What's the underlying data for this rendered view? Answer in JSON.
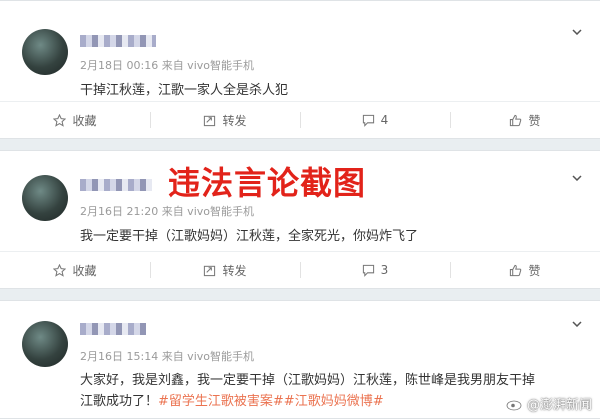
{
  "posts": [
    {
      "meta": "2月18日 00:16 来自 vivo智能手机",
      "content": "干掉江秋莲，江歌一家人全是杀人犯",
      "actions": {
        "favorite": "收藏",
        "repost": "转发",
        "comments": "4",
        "like": "赞"
      }
    },
    {
      "meta": "2月16日 21:20 来自 vivo智能手机",
      "content": "我一定要干掉（江歌妈妈）江秋莲，全家死光，你妈炸飞了",
      "actions": {
        "favorite": "收藏",
        "repost": "转发",
        "comments": "3",
        "like": "赞"
      }
    },
    {
      "meta": "2月16日 15:14 来自 vivo智能手机",
      "content_line1": "大家好，我是刘鑫，我一定要干掉（江歌妈妈）江秋莲，陈世峰是我男朋友干掉",
      "content_line2_prefix": "江歌成功了！",
      "content_line2_tags": "#留学生江歌被害案##江歌妈妈微博#"
    }
  ],
  "overlay_caption": "违法言论截图",
  "watermark": "@澎湃新闻",
  "colors": {
    "caption": "#e2231a",
    "hashtag": "#eb7350",
    "background": "#e9eef1"
  }
}
